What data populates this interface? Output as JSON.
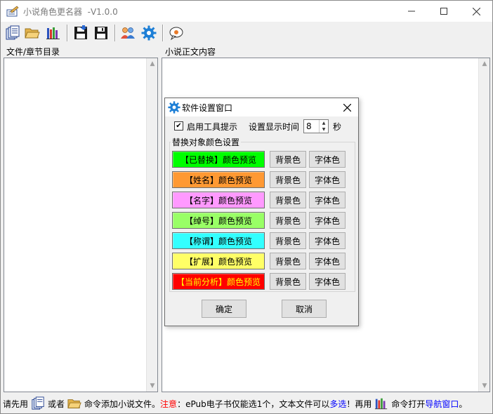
{
  "window": {
    "title": "小说角色更名器  -V1.0.0",
    "minimize_icon": "minimize-icon",
    "maximize_icon": "maximize-icon",
    "close_icon": "close-icon"
  },
  "toolbar": {
    "buttons": [
      {
        "name": "open-files-button",
        "icon": "document-stack-icon"
      },
      {
        "name": "open-folder-button",
        "icon": "folder-open-icon"
      },
      {
        "name": "navigation-button",
        "icon": "books-icon"
      },
      {
        "name": "save-as-button",
        "icon": "floppy-disk-arrow-icon"
      },
      {
        "name": "save-button",
        "icon": "floppy-disk-icon"
      },
      {
        "name": "characters-button",
        "icon": "people-icon"
      },
      {
        "name": "settings-button",
        "icon": "gear-icon"
      },
      {
        "name": "about-button",
        "icon": "speech-bubble-icon"
      }
    ]
  },
  "panes": {
    "left_label": "文件/章节目录",
    "right_label": "小说正文内容"
  },
  "status": {
    "part1": "请先用",
    "part2": "或者",
    "part3": "命令添加小说文件。",
    "note_label": "注意",
    "part4": "：ePub电子书仅能选1个，文本文件可以",
    "multi": "多选",
    "part5": "！再用",
    "part6": "命令打开",
    "nav": "导航窗口",
    "part7": "。"
  },
  "dialog": {
    "title": "软件设置窗口",
    "tooltip_checkbox_label": "启用工具提示",
    "tooltip_checked": true,
    "display_time_label": "设置显示时间",
    "display_time_value": "8",
    "seconds_label": "秒",
    "group_label": "替换对象颜色设置",
    "rows": [
      {
        "label": "【已替换】颜色预览",
        "bg": "#00ff00",
        "fg": "#000000"
      },
      {
        "label": "【姓名】颜色预览",
        "bg": "#ff9933",
        "fg": "#000000"
      },
      {
        "label": "【名字】颜色预览",
        "bg": "#ff99ff",
        "fg": "#000000"
      },
      {
        "label": "【绰号】颜色预览",
        "bg": "#99ff66",
        "fg": "#000000"
      },
      {
        "label": "【称谓】颜色预览",
        "bg": "#33ffff",
        "fg": "#000000"
      },
      {
        "label": "【扩展】颜色预览",
        "bg": "#ffff66",
        "fg": "#000000"
      },
      {
        "label": "【当前分析】颜色预览",
        "bg": "#ff0000",
        "fg": "#ffff00"
      }
    ],
    "bg_button_label": "背景色",
    "font_button_label": "字体色",
    "ok_label": "确定",
    "cancel_label": "取消"
  }
}
